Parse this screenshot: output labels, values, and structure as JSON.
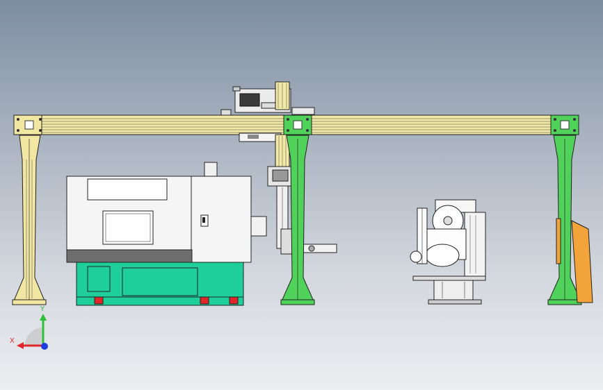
{
  "viewport": {
    "background_top": "#7d8da2",
    "background_bottom": "#eceef1"
  },
  "colors": {
    "gantry_beam": "#f3e9a6",
    "left_leg": "#f1e7a3",
    "center_leg": "#4fd15a",
    "right_leg": "#4fd15a",
    "lathe_base": "#1fcf9a",
    "lathe_cover": "#f5f5f5",
    "lathe_stripe": "#6e6e6e",
    "red_feet": "#e0252b",
    "orange_guard": "#f2a33a",
    "axis_x": "#e0252b",
    "axis_y": "#2fbf3a",
    "axis_z": "#1e3ce0"
  },
  "triad": {
    "x_label": "X",
    "y_label": "Y",
    "icon": "coordinate-triad-icon"
  }
}
